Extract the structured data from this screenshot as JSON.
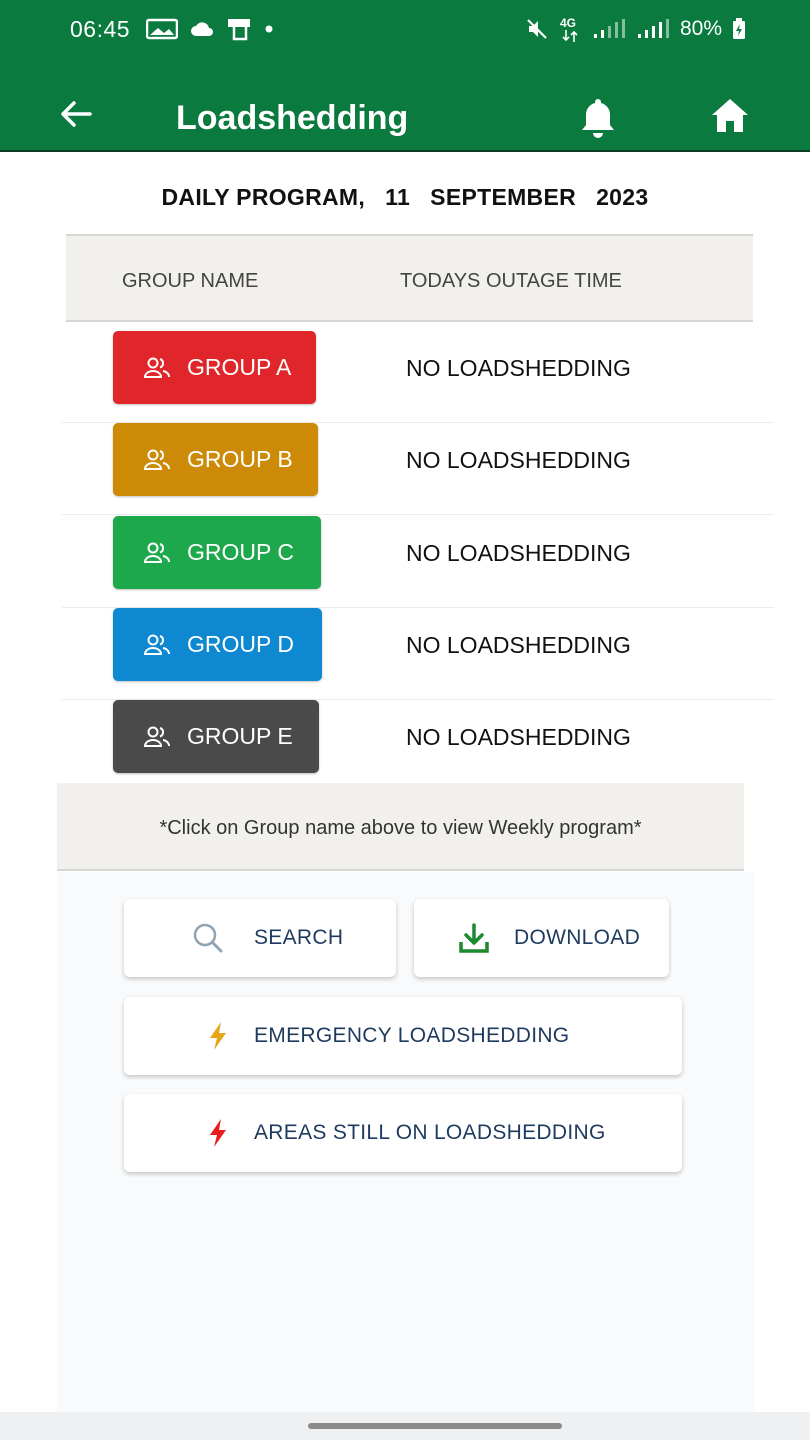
{
  "status_bar": {
    "time": "06:45",
    "battery": "80%",
    "network": "4G"
  },
  "toolbar": {
    "title": "Loadshedding",
    "back_icon": "arrow-left-icon",
    "bell_icon": "bell-icon",
    "home_icon": "home-icon"
  },
  "header": {
    "program_label": "DAILY PROGRAM,",
    "day": "11",
    "month": "SEPTEMBER",
    "year": "2023"
  },
  "table": {
    "columns": [
      "GROUP NAME",
      "TODAYS OUTAGE TIME"
    ],
    "rows": [
      {
        "group": "GROUP A",
        "outage": "NO LOADSHEDDING",
        "color": "#e0262a"
      },
      {
        "group": "GROUP B",
        "outage": "NO LOADSHEDDING",
        "color": "#cc8a06"
      },
      {
        "group": "GROUP C",
        "outage": "NO LOADSHEDDING",
        "color": "#1ea84c"
      },
      {
        "group": "GROUP D",
        "outage": "NO LOADSHEDDING",
        "color": "#0e88d0"
      },
      {
        "group": "GROUP E",
        "outage": "NO LOADSHEDDING",
        "color": "#4a4a4a"
      }
    ]
  },
  "hint": "*Click on Group name above to view Weekly program*",
  "actions": {
    "search": "SEARCH",
    "download": "DOWNLOAD",
    "emergency": "EMERGENCY LOADSHEDDING",
    "areas": "AREAS STILL ON LOADSHEDDING"
  },
  "colors": {
    "app_bar": "#0a7a3f",
    "download_icon": "#1b8a2f",
    "emergency_icon": "#e6a417",
    "areas_icon": "#e81c1c"
  }
}
